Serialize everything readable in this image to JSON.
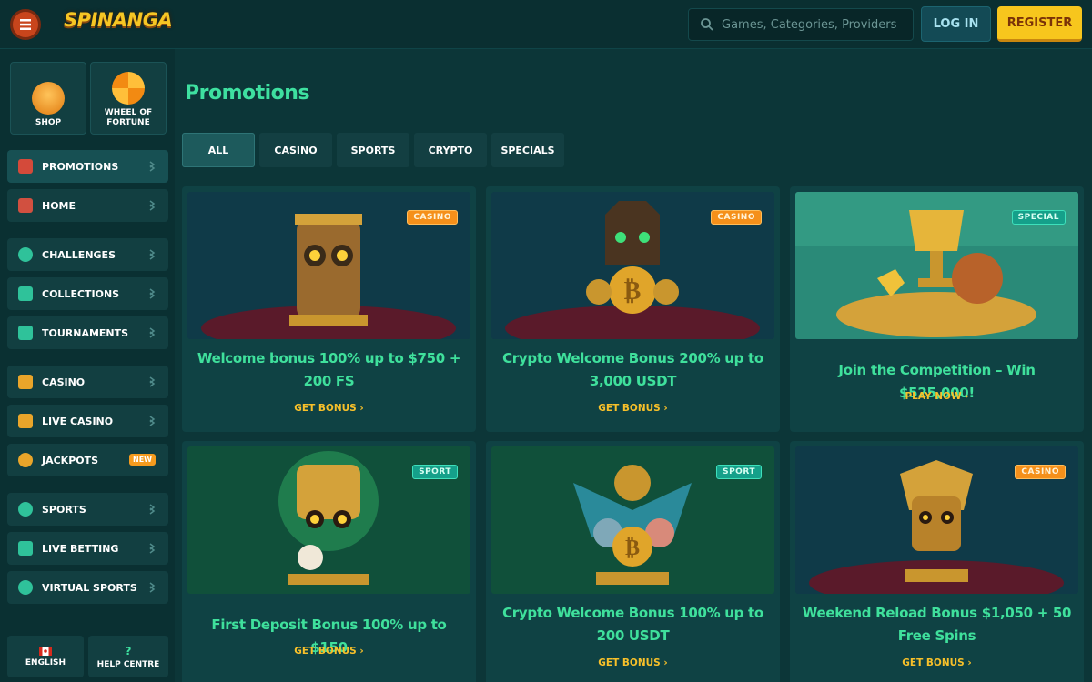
{
  "header": {
    "logo": "SPINANGA",
    "search_placeholder": "Games, Categories, Providers",
    "login_label": "LOG IN",
    "register_label": "REGISTER"
  },
  "sidebar": {
    "tiles": [
      {
        "label": "SHOP",
        "icon": "basket-icon"
      },
      {
        "label": "WHEEL OF FORTUNE",
        "icon": "wheel-icon"
      }
    ],
    "items": [
      {
        "label": "PROMOTIONS",
        "icon": "gift-icon",
        "active": true
      },
      {
        "label": "HOME",
        "icon": "home-icon"
      },
      {
        "label": "CHALLENGES",
        "icon": "target-icon"
      },
      {
        "label": "COLLECTIONS",
        "icon": "cards-icon"
      },
      {
        "label": "TOURNAMENTS",
        "icon": "trophy-icon"
      },
      {
        "label": "CASINO",
        "icon": "chest-icon"
      },
      {
        "label": "LIVE CASINO",
        "icon": "person-icon"
      },
      {
        "label": "JACKPOTS",
        "icon": "clover-icon",
        "badge": "NEW"
      },
      {
        "label": "SPORTS",
        "icon": "soccer-icon"
      },
      {
        "label": "LIVE BETTING",
        "icon": "live-icon"
      },
      {
        "label": "VIRTUAL SPORTS",
        "icon": "virtual-icon"
      }
    ],
    "footer": [
      {
        "label": "ENGLISH",
        "icon": "canada-flag-icon"
      },
      {
        "label": "HELP CENTRE",
        "icon": "question-icon"
      }
    ]
  },
  "main": {
    "title": "Promotions",
    "filters": [
      "ALL",
      "CASINO",
      "SPORTS",
      "CRYPTO",
      "SPECIALS"
    ],
    "active_filter": "ALL",
    "cards": [
      {
        "title": "Welcome bonus 100% up to $750 + 200 FS",
        "cta": "GET BONUS",
        "badge": "CASINO"
      },
      {
        "title": "Crypto Welcome Bonus 200% up to 3,000 USDT",
        "cta": "GET BONUS",
        "badge": "CASINO"
      },
      {
        "title": "Join the Competition – Win $525,000!",
        "cta": "PLAY NOW",
        "badge": "SPECIAL"
      },
      {
        "title": "First Deposit Bonus 100% up to $150",
        "cta": "GET BONUS",
        "badge": "SPORT"
      },
      {
        "title": "Crypto Welcome Bonus 100% up to 200 USDT",
        "cta": "GET BONUS",
        "badge": "SPORT"
      },
      {
        "title": "Weekend Reload Bonus $1,050 + 50 Free Spins",
        "cta": "GET BONUS",
        "badge": "CASINO"
      }
    ]
  },
  "colors": {
    "accent_green": "#3ee0a0",
    "cta_yellow": "#f7c02a",
    "casino_badge": "#f5901a",
    "sport_badge": "#15a08a"
  }
}
